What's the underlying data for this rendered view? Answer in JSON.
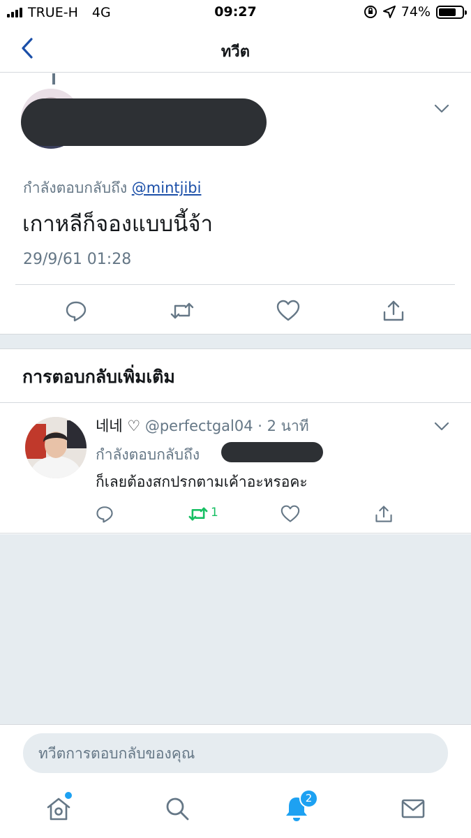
{
  "status_bar": {
    "carrier": "TRUE-H",
    "network": "4G",
    "time": "09:27",
    "battery_percent": "74%",
    "battery_level": 0.74
  },
  "nav": {
    "title": "ทวีต"
  },
  "main_tweet": {
    "replying_to_label": "กำลังตอบกลับถึง",
    "replying_to_handle": "@mintjibi",
    "text": "เกาหลีก็จองแบบนี้จ้า",
    "timestamp": "29/9/61 01:28"
  },
  "more_replies": {
    "header": "การตอบกลับเพิ่มเติม"
  },
  "reply": {
    "name": "네네 ♡",
    "handle_time": "@perfectgal04 · 2 นาที",
    "replying_to_label": "กำลังตอบกลับถึง",
    "text": "ก็เลยต้องสกปรกตามเค้าอะหรอคะ",
    "retweet_count": "1"
  },
  "composer": {
    "placeholder": "ทวีตการตอบกลับของคุณ"
  },
  "tab_bar": {
    "notification_badge": "2"
  },
  "colors": {
    "accent": "#1da1f2",
    "link": "#1b4fa8",
    "retweet_green": "#17bf63",
    "muted": "#657786",
    "background_gray": "#e6ecf0"
  }
}
